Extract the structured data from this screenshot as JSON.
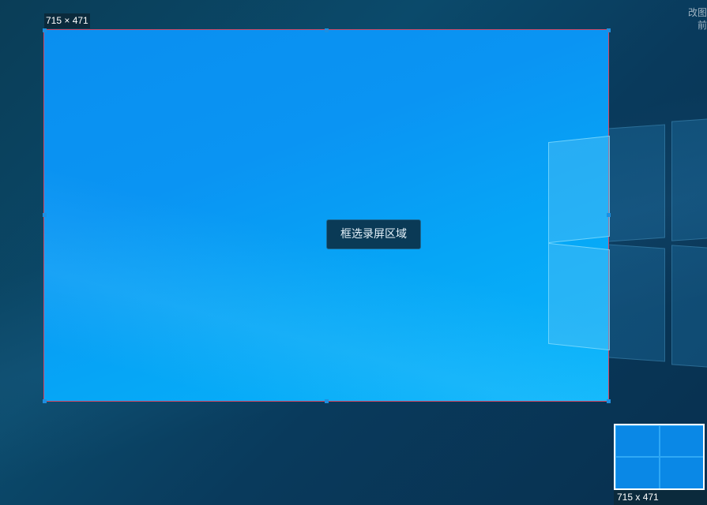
{
  "overlay": {
    "size_label": "715 × 471",
    "center_button_label": "框选录屏区域",
    "preview_label": "715 x 471",
    "top_right_text_line1": "改图",
    "top_right_text_line2": "前"
  },
  "colors": {
    "selection_border": "#d04a6a",
    "handle": "#1e8fe0",
    "label_bg": "#0b2a3c",
    "selection_fill_start": "#0a8ff0",
    "selection_fill_end": "#09b6fb"
  },
  "icons": [
    "windows-logo-icon"
  ]
}
